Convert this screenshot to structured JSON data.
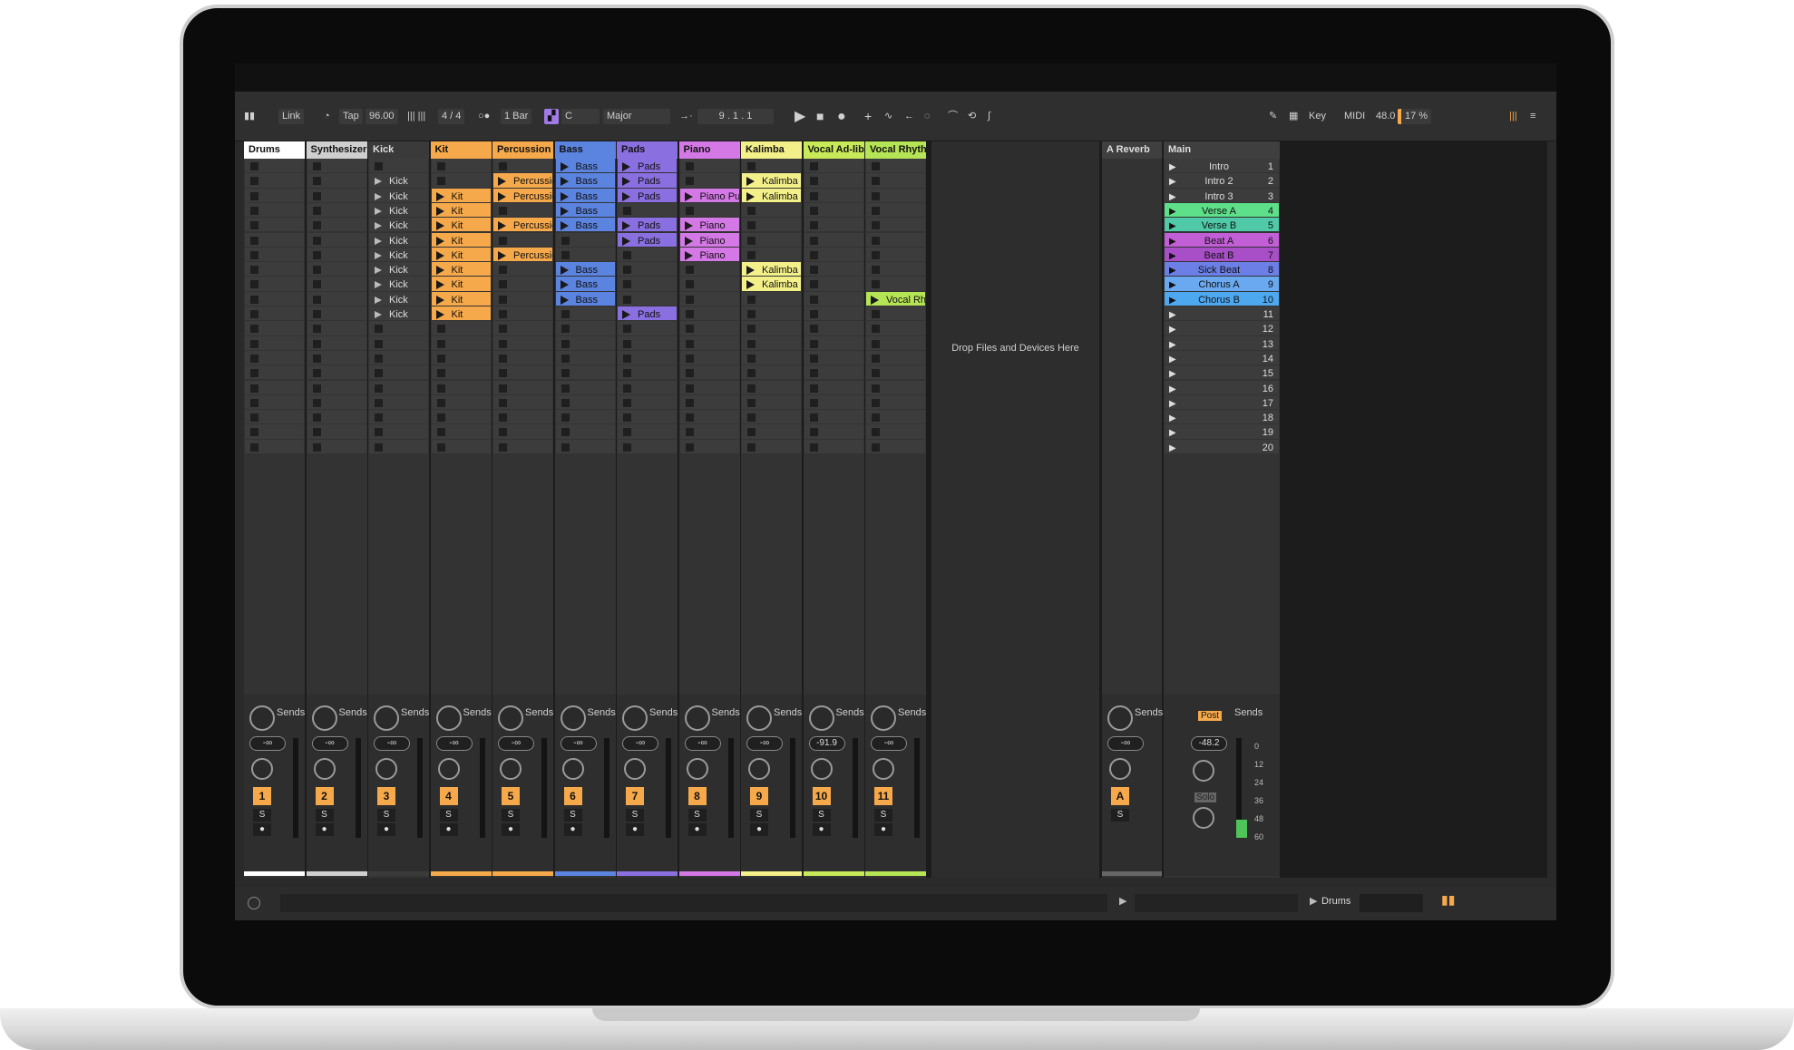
{
  "toolbar": {
    "link": "Link",
    "tap": "Tap",
    "tempo": "96.00",
    "signature": "4 / 4",
    "quantize": "1 Bar",
    "key": "C",
    "scale": "Major",
    "position": "9 .  1 .  1",
    "key_label": "Key",
    "midi_label": "MIDI",
    "zoom": "48.0",
    "cpu": "17 %"
  },
  "tracks": [
    {
      "name": "Drums",
      "color": "#ffffff",
      "num": "1",
      "vol": "-∞",
      "clips": []
    },
    {
      "name": "Synthesizer",
      "color": "#cfcfcf",
      "num": "2",
      "vol": "-∞",
      "clips": []
    },
    {
      "name": "Kick",
      "color": "#3a3a3a",
      "num": "3",
      "vol": "-∞",
      "clips": [
        "",
        "Kick",
        "Kick",
        "Kick",
        "Kick",
        "Kick",
        "Kick",
        "Kick",
        "Kick",
        "Kick",
        "Kick"
      ]
    },
    {
      "name": "Kit",
      "color": "#f6a94a",
      "num": "4",
      "vol": "-∞",
      "clips": [
        "",
        "",
        "Kit",
        "Kit",
        "Kit",
        "Kit",
        "Kit",
        "Kit",
        "Kit",
        "Kit",
        "Kit"
      ]
    },
    {
      "name": "Percussion",
      "color": "#f6a94a",
      "num": "5",
      "vol": "-∞",
      "clips": [
        "",
        "Percussion",
        "Percussion",
        "",
        "Percussion",
        "",
        "Percussion",
        "",
        "",
        "",
        ""
      ]
    },
    {
      "name": "Bass",
      "color": "#5b84e0",
      "num": "6",
      "vol": "-∞",
      "clips": [
        "Bass",
        "Bass",
        "Bass",
        "Bass",
        "Bass",
        "",
        "",
        "Bass",
        "Bass",
        "Bass",
        ""
      ]
    },
    {
      "name": "Pads",
      "color": "#8a6fe0",
      "num": "7",
      "vol": "-∞",
      "clips": [
        "Pads",
        "Pads",
        "Pads",
        "",
        "Pads",
        "Pads",
        "",
        "",
        "",
        "",
        "Pads"
      ]
    },
    {
      "name": "Piano",
      "color": "#d478e6",
      "num": "8",
      "vol": "-∞",
      "clips": [
        "",
        "",
        "Piano Pulse",
        "",
        "Piano",
        "Piano",
        "Piano",
        "",
        "",
        "",
        ""
      ]
    },
    {
      "name": "Kalimba",
      "color": "#f3f08a",
      "num": "9",
      "vol": "-∞",
      "clips": [
        "",
        "Kalimba",
        "Kalimba",
        "",
        "",
        "",
        "",
        "Kalimba",
        "Kalimba",
        "",
        ""
      ]
    },
    {
      "name": "Vocal Ad-libs",
      "color": "#c8ea58",
      "num": "10",
      "vol": "-91.9",
      "clips": []
    },
    {
      "name": "Vocal Rhythm",
      "color": "#b5e455",
      "num": "11",
      "vol": "-∞",
      "clips": [
        "",
        "",
        "",
        "",
        "",
        "",
        "",
        "",
        "",
        "Vocal Rhyhm",
        ""
      ]
    }
  ],
  "drop_zone": "Drop Files and Devices Here",
  "return_track": {
    "name": "A Reverb",
    "num": "A",
    "vol": "-∞"
  },
  "main_track": {
    "name": "Main",
    "vol": "-48.2",
    "post": "Post",
    "solo": "Solo",
    "scale": [
      "0",
      "12",
      "24",
      "36",
      "48",
      "60"
    ]
  },
  "sends_label": "Sends",
  "solo_label": "S",
  "scenes": [
    {
      "name": "Intro",
      "num": "1",
      "color": ""
    },
    {
      "name": "Intro 2",
      "num": "2",
      "color": ""
    },
    {
      "name": "Intro 3",
      "num": "3",
      "color": ""
    },
    {
      "name": "Verse A",
      "num": "4",
      "color": "#5ee08a"
    },
    {
      "name": "Verse B",
      "num": "5",
      "color": "#4fc9a8"
    },
    {
      "name": "Beat A",
      "num": "6",
      "color": "#c25fd6"
    },
    {
      "name": "Beat B",
      "num": "7",
      "color": "#a84fc7"
    },
    {
      "name": "Sick Beat",
      "num": "8",
      "color": "#6b7fe6"
    },
    {
      "name": "Chorus A",
      "num": "9",
      "color": "#6aa9f0"
    },
    {
      "name": "Chorus B",
      "num": "10",
      "color": "#4ea8f0"
    },
    {
      "name": "",
      "num": "11",
      "color": ""
    },
    {
      "name": "",
      "num": "12",
      "color": ""
    },
    {
      "name": "",
      "num": "13",
      "color": ""
    },
    {
      "name": "",
      "num": "14",
      "color": ""
    },
    {
      "name": "",
      "num": "15",
      "color": ""
    },
    {
      "name": "",
      "num": "16",
      "color": ""
    },
    {
      "name": "",
      "num": "17",
      "color": ""
    },
    {
      "name": "",
      "num": "18",
      "color": ""
    },
    {
      "name": "",
      "num": "19",
      "color": ""
    },
    {
      "name": "",
      "num": "20",
      "color": ""
    }
  ],
  "status": {
    "track": "Drums"
  }
}
